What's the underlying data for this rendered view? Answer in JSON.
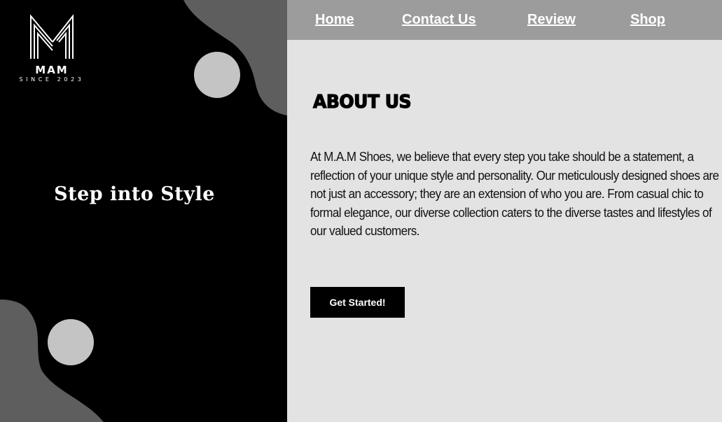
{
  "hero": {
    "logo_brand": "MAM",
    "logo_since": "SINCE 2023",
    "tagline": "Step into Style"
  },
  "nav": {
    "items": [
      {
        "label": "Home"
      },
      {
        "label": "Contact Us"
      },
      {
        "label": "Review"
      },
      {
        "label": "Shop"
      }
    ]
  },
  "about": {
    "heading": "ABOUT US",
    "body": "At M.A.M Shoes, we believe that every step you take should be a statement, a reflection of your unique style and personality. Our meticulously designed shoes are not just an accessory; they are an extension of who you are. From casual chic to formal elegance, our diverse collection caters to the diverse tastes and lifestyles of our valued customers.",
    "cta_label": "Get Started!"
  },
  "colors": {
    "hero_bg": "#000000",
    "hero_shape": "#5e5e5e",
    "hero_circle": "#c4c4c4",
    "nav_bg": "#9c9c9c",
    "content_bg": "#e3e3e3",
    "button_bg": "#000000"
  }
}
